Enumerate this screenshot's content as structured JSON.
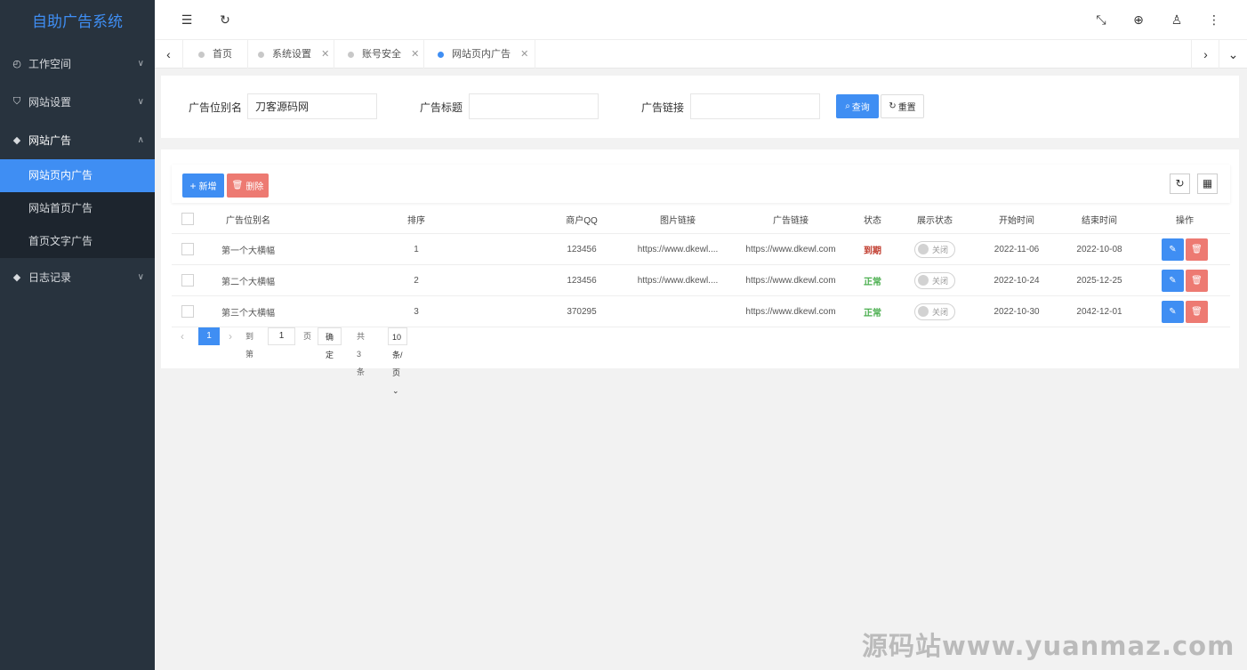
{
  "app": {
    "title": "自助广告系统"
  },
  "sidebar": {
    "items": [
      {
        "label": "工作空间",
        "icon": "dashboard-icon",
        "expanded": false
      },
      {
        "label": "网站设置",
        "icon": "shield-icon",
        "expanded": false
      },
      {
        "label": "网站广告",
        "icon": "layers-icon",
        "expanded": true,
        "children": [
          {
            "label": "网站页内广告",
            "active": true
          },
          {
            "label": "网站首页广告",
            "active": false
          },
          {
            "label": "首页文字广告",
            "active": false
          }
        ]
      },
      {
        "label": "日志记录",
        "icon": "layers-icon",
        "expanded": false
      }
    ]
  },
  "header": {
    "icons": [
      "menu-fold-icon",
      "refresh-icon",
      "fullscreen-icon",
      "globe-icon",
      "user-icon",
      "more-icon"
    ]
  },
  "tabs": [
    {
      "label": "首页",
      "closable": false,
      "active": false
    },
    {
      "label": "系统设置",
      "closable": true,
      "active": false
    },
    {
      "label": "账号安全",
      "closable": true,
      "active": false
    },
    {
      "label": "网站页内广告",
      "closable": true,
      "active": true
    }
  ],
  "search": {
    "fields": [
      {
        "label": "广告位别名",
        "value": "刀客源码网",
        "placeholder": ""
      },
      {
        "label": "广告标题",
        "value": "",
        "placeholder": ""
      },
      {
        "label": "广告链接",
        "value": "",
        "placeholder": ""
      }
    ],
    "query_label": "查询",
    "reset_label": "重置"
  },
  "toolbar": {
    "add_label": "新增",
    "delete_label": "删除"
  },
  "table": {
    "columns": [
      "广告位别名",
      "排序",
      "商户QQ",
      "图片链接",
      "广告链接",
      "状态",
      "展示状态",
      "开始时间",
      "结束时间",
      "操作"
    ],
    "rows": [
      {
        "name": "第一个大横幅",
        "sort": "1",
        "qq": "123456",
        "img": "https://www.dkewl....",
        "link": "https://www.dkewl.com",
        "status": "到期",
        "status_type": "bad",
        "display": "关闭",
        "start": "2022-11-06",
        "end": "2022-10-08"
      },
      {
        "name": "第二个大横幅",
        "sort": "2",
        "qq": "123456",
        "img": "https://www.dkewl....",
        "link": "https://www.dkewl.com",
        "status": "正常",
        "status_type": "ok",
        "display": "关闭",
        "start": "2022-10-24",
        "end": "2025-12-25"
      },
      {
        "name": "第三个大横幅",
        "sort": "3",
        "qq": "370295",
        "img": "",
        "link": "https://www.dkewl.com",
        "status": "正常",
        "status_type": "ok",
        "display": "关闭",
        "start": "2022-10-30",
        "end": "2042-12-01"
      }
    ]
  },
  "pager": {
    "current": "1",
    "goto_prefix": "到第",
    "goto_value": "1",
    "goto_suffix": "页",
    "confirm_label": "确定",
    "total_label": "共 3 条",
    "page_size_label": "10 条/页"
  },
  "watermark": "源码站www.yuanmaz.com",
  "colors": {
    "primary": "#3f8ef3",
    "danger": "#ed7a72",
    "sidebar_bg": "#28333e",
    "ok": "#4caf50",
    "bad": "#c0392b"
  }
}
